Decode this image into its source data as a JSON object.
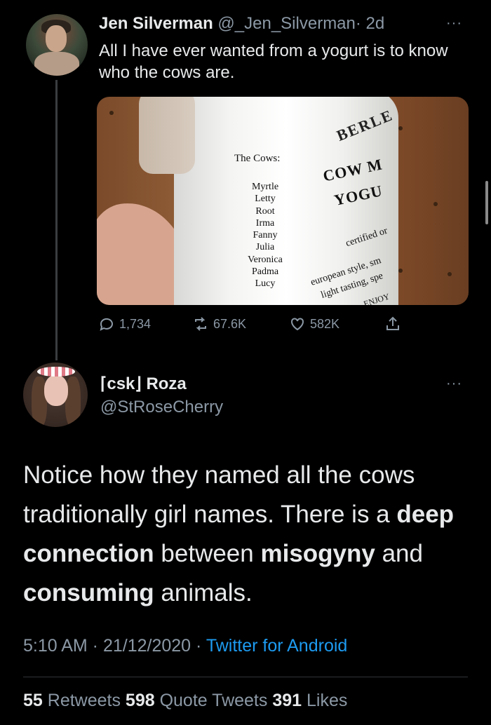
{
  "tweet1": {
    "name": "Jen Silverman",
    "handle": "@_Jen_Silverman",
    "time": "· 2d",
    "more": "···",
    "text": "All I have ever wanted from a yogurt is to know who the cows are.",
    "photo": {
      "cows_label": "The Cows:",
      "cows": [
        "Myrtle",
        "Letty",
        "Root",
        "Irma",
        "Fanny",
        "Julia",
        "Veronica",
        "Padma",
        "Lucy"
      ],
      "brand": "BERLE",
      "product_line1": "COW M",
      "product_line2": "YOGU",
      "certified": "certified or",
      "european": "european style, sm",
      "light": "light tasting, spe",
      "enjoy": "ENJOY"
    },
    "replies": "1,734",
    "retweets": "67.6K",
    "likes": "582K"
  },
  "tweet2": {
    "name": "⌈csk⌋ Roza",
    "handle": "@StRoseCherry",
    "more": "···",
    "text_parts": {
      "p1": "Notice how they named all the cows traditionally girl names. There is a ",
      "b1": "deep connection",
      "p2": " between ",
      "b2": "misogyny",
      "p3": " and ",
      "b3": "consuming",
      "p4": " animals."
    },
    "time": "5:10 AM · 21/12/2020 · ",
    "source": "Twitter for Android",
    "stats": {
      "retweets_count": "55",
      "retweets_label": " Retweets ",
      "quotes_count": "598",
      "quotes_label": " Quote Tweets ",
      "likes_count": "391",
      "likes_label": " Likes"
    }
  }
}
